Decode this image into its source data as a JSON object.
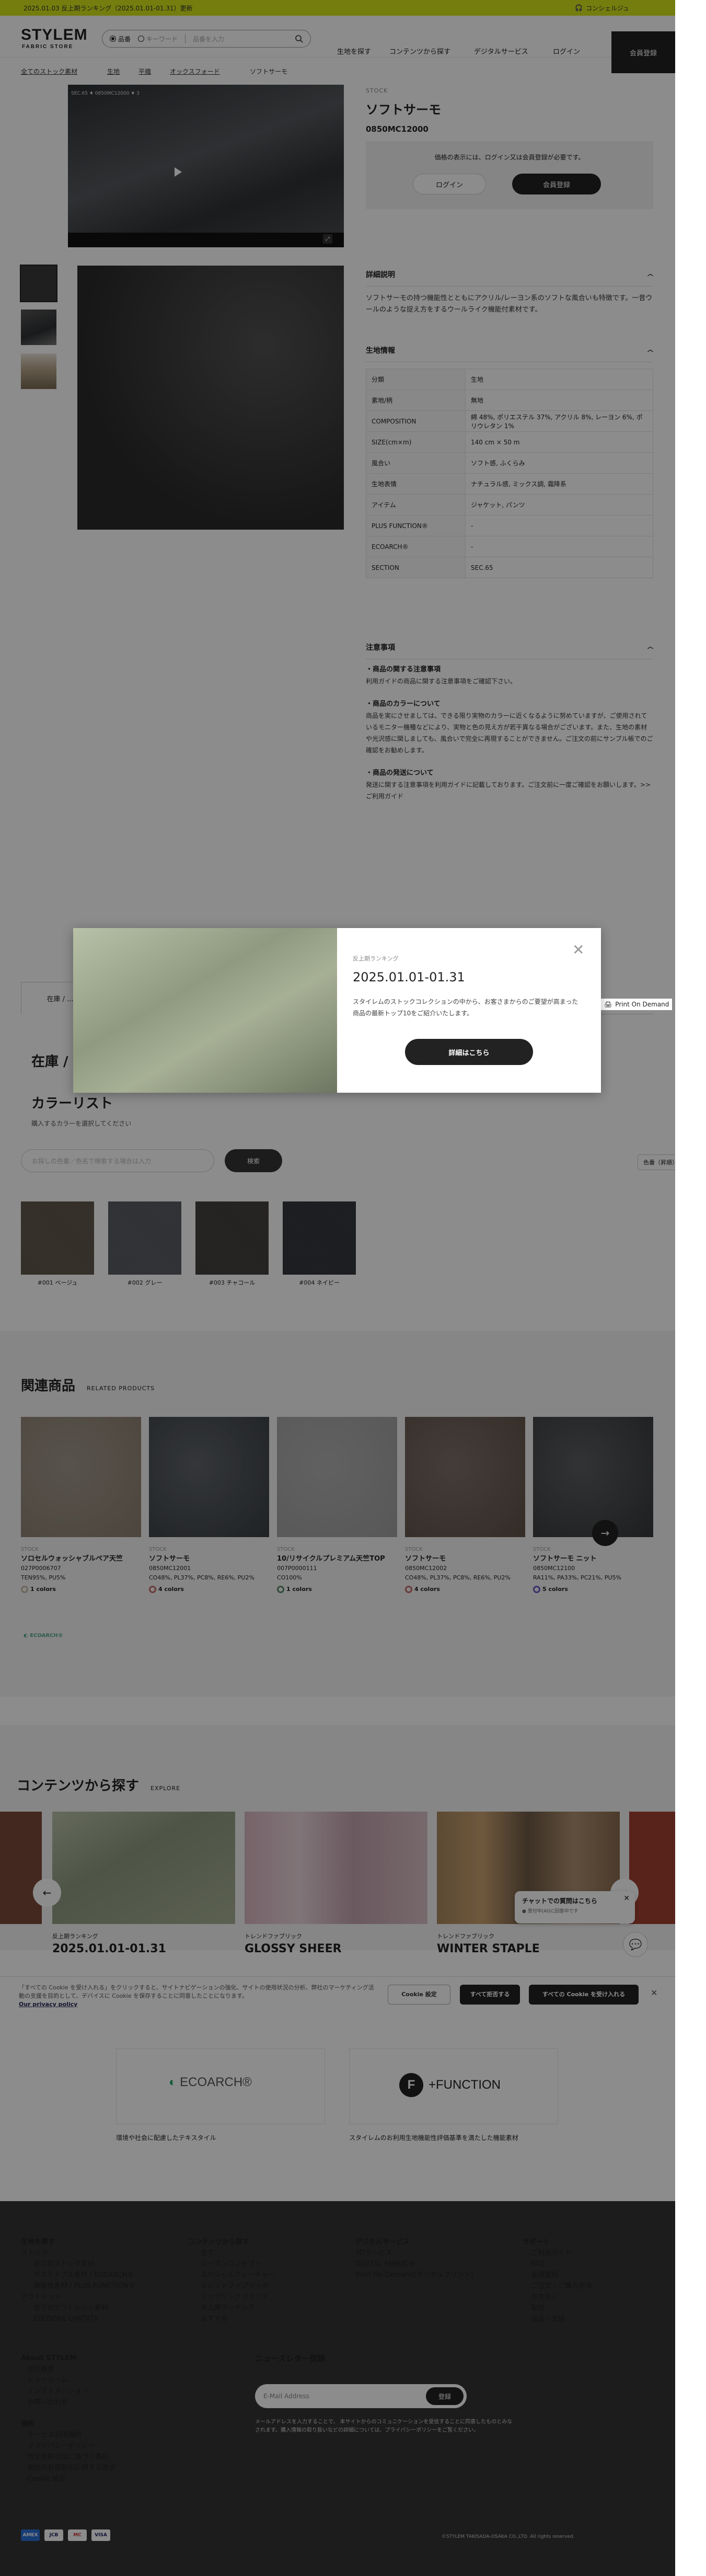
{
  "announcement": {
    "text": "2025.01.03 反上期ランキング（2025.01.01-01.31）更新",
    "concierge": "コンシェルジュ"
  },
  "header": {
    "logo_line1": "STYLEM",
    "logo_line2": "FABRIC STORE",
    "search": {
      "radio_product": "品番",
      "radio_keyword": "キーワード",
      "placeholder": "品番を入力"
    },
    "nav": [
      "生地を探す",
      "コンテンツから探す",
      "デジタルサービス"
    ],
    "login": "ログイン",
    "register": "会員登録"
  },
  "breadcrumb": [
    "全てのストック素材",
    "生地",
    "平織",
    "オックスフォード",
    "ソフトサーモ"
  ],
  "video": {
    "tag": "SEC.65 ♦ 0850MC12000 ♦ 3"
  },
  "product": {
    "stock_label": "STOCK",
    "title": "ソフトサーモ",
    "code": "0850MC12000",
    "price_note": "価格の表示には、ログイン又は会員登録が必要です。",
    "login_button": "ログイン",
    "register_button": "会員登録"
  },
  "details": {
    "heading": "詳細説明",
    "body": "ソフトサーモの持つ機能性とともにアクリル/レーヨン系のソフトな風合いも特徴です。一昔ウールのような捉え方をするウールライク機能付素材です。"
  },
  "spec": {
    "heading": "生地情報",
    "rows": [
      {
        "k": "分類",
        "v": "生地"
      },
      {
        "k": "素地/柄",
        "v": "無地"
      },
      {
        "k": "COMPOSITION",
        "v": "綿 48%, ポリエステル 37%, アクリル 8%, レーヨン 6%, ポリウレタン 1%"
      },
      {
        "k": "SIZE(cm×m)",
        "v": "140 cm × 50 m"
      },
      {
        "k": "風合い",
        "v": "ソフト感, ふくらみ"
      },
      {
        "k": "生地表情",
        "v": "ナチュラル感, ミックス調, 霜降系"
      },
      {
        "k": "アイテム",
        "v": "ジャケット, パンツ"
      },
      {
        "k": "PLUS FUNCTION®",
        "v": "-"
      },
      {
        "k": "ECOARCH®",
        "v": "-"
      },
      {
        "k": "SECTION",
        "v": "SEC.65"
      }
    ]
  },
  "notes": {
    "heading": "注意事項",
    "blocks": [
      {
        "title": "・商品の関する注意事項",
        "body": "利用ガイドの商品に関する注意事項をご確認下さい。"
      },
      {
        "title": "・商品のカラーについて",
        "body": "商品を実にさせましては、できる限り実物のカラーに近くなるように努めていますが、ご使用されているモニター機種などにより、実物と色の見え方が若干異なる場合がございます。また、生地の素材や光沢感に関しましても、風合いで完全に再現することができません。ご注文の前にサンプル帳でのご確認をお勧めします。"
      },
      {
        "title": "・商品の発送について",
        "body": "発送に関する注意事項を利用ガイドに記載しております。ご注文前に一度ご確認をお願いします。>> ご利用ガイド"
      }
    ]
  },
  "tabs": {
    "stock": "在庫 / ...",
    "print_on_demand": "Print On Demand"
  },
  "stock_heading": "在庫 /",
  "color_list": {
    "heading": "カラーリスト",
    "sub": "購入するカラーを選択してください",
    "input_placeholder": "お探しの色番／色名で検索する場合は入力",
    "search_button": "検索",
    "sort": "色番（昇順）",
    "swatches": [
      {
        "label": "#001 ベージュ",
        "color": "#5c5247"
      },
      {
        "label": "#002 グレー",
        "color": "#54585d"
      },
      {
        "label": "#003 チャコール",
        "color": "#3e3c3a"
      },
      {
        "label": "#004 ネイビー",
        "color": "#2f3238"
      }
    ]
  },
  "related": {
    "heading": "関連商品",
    "sub": "RELATED PRODUCTS",
    "items": [
      {
        "stock": "STOCK",
        "name": "ソロセルウォッシャブルペア天竺",
        "code": "027P0006707",
        "comp": "TEN95%, PU5%",
        "colors": "1 colors",
        "img": "#8a7f70",
        "ring": "#c8b9a5"
      },
      {
        "stock": "STOCK",
        "name": "ソフトサーモ",
        "code": "0850MC12001",
        "comp": "CO48%, PL37%, PC8%, RE6%, PU2%",
        "colors": "4 colors",
        "img": "#3a3f45",
        "ring": "#c46a6a"
      },
      {
        "stock": "STOCK",
        "name": "10/リサイクルプレミアム天竺TOP",
        "code": "007P0000111",
        "comp": "CO100%",
        "colors": "1 colors",
        "img": "#a0a0a0",
        "ring": "#5a8c6a"
      },
      {
        "stock": "STOCK",
        "name": "ソフトサーモ",
        "code": "0850MC12002",
        "comp": "CO48%, PL37%, PC8%, RE6%, PU2%",
        "colors": "4 colors",
        "img": "#5e5047",
        "ring": "#c46a6a"
      },
      {
        "stock": "STOCK",
        "name": "ソフトサーモ ニット",
        "code": "0850MC12100",
        "comp": "RA11%, PA33%, PC21%, PU5%",
        "colors": "5 colors",
        "img": "#36383a",
        "ring": "#6a5ac4"
      }
    ]
  },
  "contents": {
    "heading": "コンテンツから探す",
    "sub": "EXPLORE",
    "cards": [
      {
        "label": "反上期ランキング",
        "title": "2025.01.01-01.31"
      },
      {
        "label": "トレンドファブリック",
        "title": "GLOSSY SHEER"
      },
      {
        "label": "トレンドファブリック",
        "title": "WINTER STAPLE"
      }
    ]
  },
  "chat": {
    "title": "チャットでの質問はこちら",
    "sub": "● 受付中(AI)に回答中です"
  },
  "cookie": {
    "text": "「すべての Cookie を受け入れる」をクリックすると、サイトナビゲーションの強化、サイトの使用状況の分析、弊社のマーケティング活動の支援を目的として、デバイスに Cookie を保存することに同意したことになります。",
    "policy": "Our privacy policy",
    "settings": "Cookie 設定",
    "reject": "すべて拒否する",
    "accept": "すべての Cookie を受け入れる"
  },
  "banners": [
    {
      "name": "ECOARCH®",
      "caption": "環境や社会に配慮したテキスタイル"
    },
    {
      "name": "+FUNCTION",
      "caption": "スタイレムのお利用生地機能性評価基準を満たした機能素材"
    }
  ],
  "footer": {
    "col1": [
      "生地を探す",
      "ストック",
      "全てのストック素材",
      "サステナブル素材 / ECOARCH®",
      "機能性素材 / PLUS FUNCTION®",
      "アウトレット",
      "全てのアウトレット素材",
      "EDIZIONE LIMITATA"
    ],
    "col2": [
      "コンテンツから探す",
      "全て",
      "シーズンコンセプト",
      "スペシャルフィーチャー",
      "トレンドファブリック",
      "ファブリックブランド",
      "反上期ランキング",
      "おすすめ"
    ],
    "col3": [
      "デジタルサービス",
      "3Dサービス",
      "DIGITAL FABRIC®",
      "Print On Demand(デジタルプリント)"
    ],
    "col4": [
      "サポート",
      "ご利用ガイド",
      "FAQ",
      "会員登録",
      "ご注文・ご購入方法",
      "お支払い",
      "配送",
      "返品・交換"
    ],
    "about": [
      "About STYLEM",
      "会社概要",
      "ショールーム",
      "インフォメーション",
      "お問い合わせ"
    ],
    "rules": [
      "規約",
      "サービス利用規約",
      "プライバシーポリシー",
      "特定商取引法に基づく表記",
      "個社内有償取引に関する表示",
      "Cookie 設定"
    ],
    "newsletter": "ニュースレター登録",
    "email_placeholder": "E-Mail Address",
    "email_button": "登録",
    "newsletter_text": "メールアドレスを入力することで、 本サイトからのコミュニケーションを受信することに同意したものとみなされます。購入情報の取り扱いなどの詳細については、プライバシーポリシーをご覧ください。",
    "payments": [
      "AMEX",
      "JCB",
      "MC",
      "VISA"
    ],
    "copyright": "©STYLEM TAKISADA-OSAKA CO.,LTD. All rights reserved."
  },
  "modal": {
    "label": "反上期ランキング",
    "date": "2025.01.01-01.31",
    "body": "スタイレムのストックコレクションの中から、お客さまからのご要望が高まった商品の最新トップ10をご紹介いたします。",
    "button": "詳細はこちら"
  }
}
